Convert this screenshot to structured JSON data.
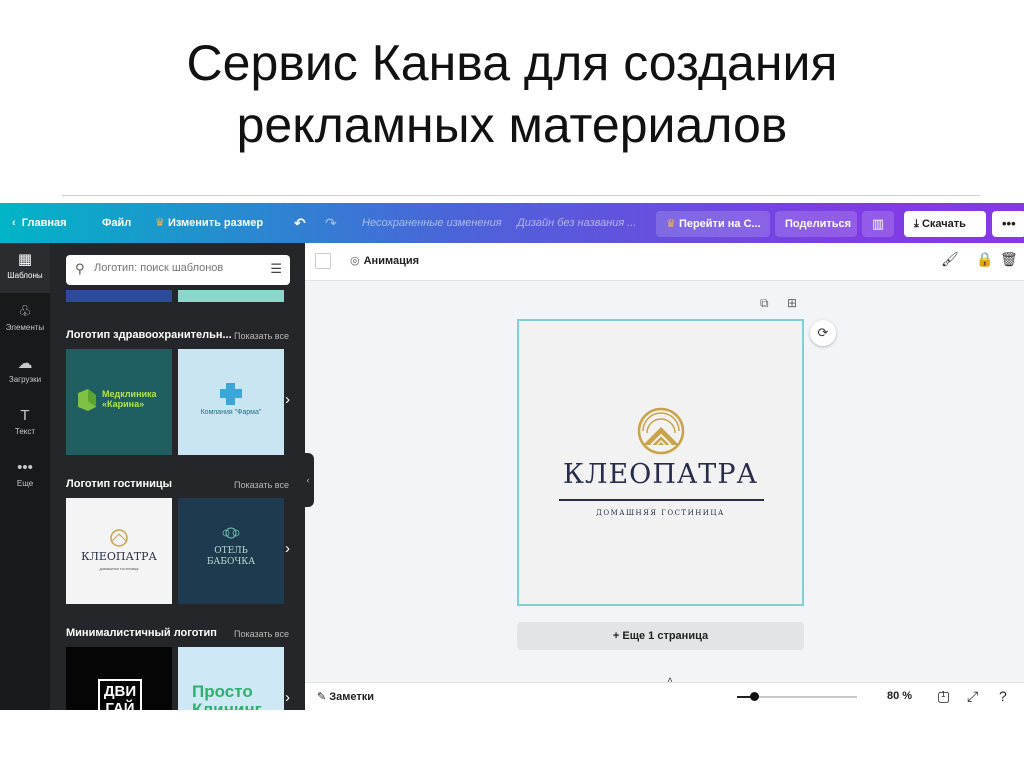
{
  "slide": {
    "title_line1": "Сервис Канва для создания",
    "title_line2": "рекламных материалов"
  },
  "topbar": {
    "home": "Главная",
    "file": "Файл",
    "resize": "Изменить размер",
    "unsaved": "Несохраненные изменения",
    "design_name": "Дизайн без названия ...",
    "premium": "Перейти на С...",
    "share": "Поделиться",
    "download": "Скачать",
    "more": "•••"
  },
  "rail": {
    "templates": "Шаблоны",
    "elements": "Элементы",
    "uploads": "Загрузки",
    "text": "Текст",
    "more": "Еще"
  },
  "panel": {
    "search_placeholder": "Логотип: поиск шаблонов",
    "show_all": "Показать все",
    "sections": [
      {
        "title": "Логотип здравоохранительн...",
        "thumbs": [
          {
            "line1": "Медклиника",
            "line2": "«Карина»"
          },
          {
            "line1": "Компания \"Фарма\""
          }
        ]
      },
      {
        "title": "Логотип гостиницы",
        "thumbs": [
          {
            "line1": "КЛЕОПАТРА",
            "line2": "домашняя гостиница"
          },
          {
            "line1": "ОТЕЛЬ",
            "line2": "БАБОЧКА"
          }
        ]
      },
      {
        "title": "Минималистичный логотип",
        "thumbs": [
          {
            "line1": "ДВИ",
            "line2": "ГАЙ"
          },
          {
            "line1": "Просто",
            "line2": "Клининг"
          }
        ]
      }
    ]
  },
  "editor": {
    "animation": "Анимация",
    "brand_name": "КЛЕОПАТРА",
    "brand_sub": "ДОМАШНЯЯ ГОСТИНИЦА",
    "add_page": "+ Еще 1 страница",
    "notes": "Заметки",
    "zoom": "80 %",
    "zoom_fraction": 0.14,
    "page_count": "1"
  },
  "colors": {
    "gradient_start": "#00b5c6",
    "gradient_end": "#8a36e6",
    "brand_gold": "#c9a24a",
    "brand_navy": "#262c4a",
    "page_border": "#7fd0d7"
  }
}
